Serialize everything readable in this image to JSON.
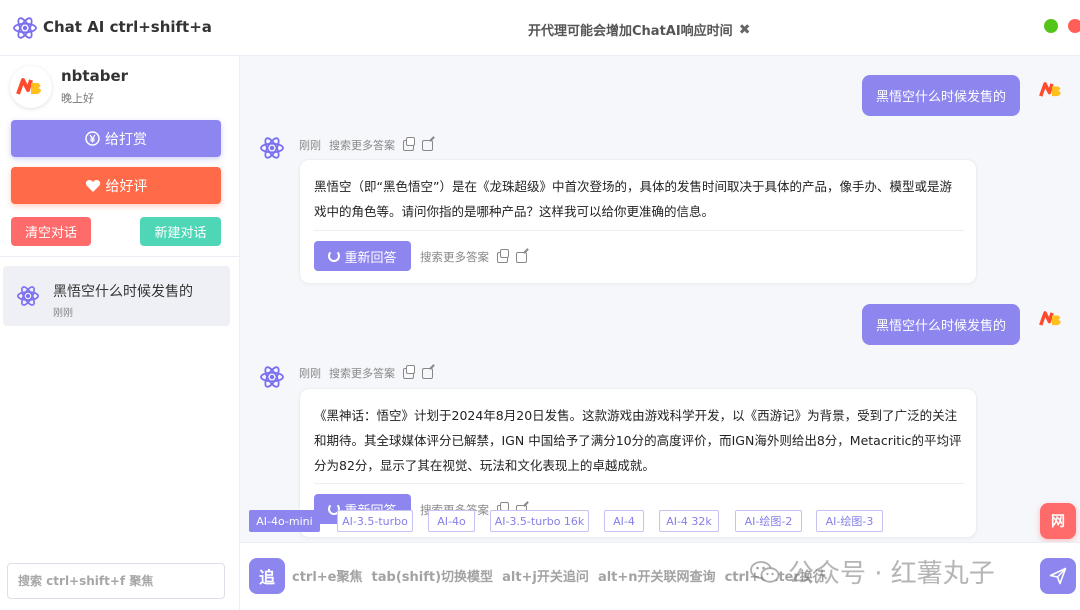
{
  "app": {
    "title": "Chat AI ctrl+shift+a",
    "notice": "开代理可能会增加ChatAI响应时间",
    "notice_close": "✖"
  },
  "sidebar": {
    "username": "nbtaber",
    "greeting": "晚上好",
    "reward_label": "给打赏",
    "review_label": "给好评",
    "clear_label": "清空对话",
    "new_label": "新建对话",
    "conversations": [
      {
        "title": "黑悟空什么时候发售的",
        "time": "刚刚"
      }
    ],
    "search_placeholder": "搜索 ctrl+shift+f 聚焦"
  },
  "chat": {
    "messages": [
      {
        "role": "user",
        "text": "黑悟空什么时候发售的"
      },
      {
        "role": "bot",
        "time": "刚刚",
        "more_answers": "搜索更多答案",
        "text": "黑悟空（即“黑色悟空”）是在《龙珠超级》中首次登场的，具体的发售时间取决于具体的产品，像手办、模型或是游戏中的角色等。请问你指的是哪种产品？这样我可以给你更准确的信息。",
        "regenerate": "重新回答"
      },
      {
        "role": "user",
        "text": "黑悟空什么时候发售的"
      },
      {
        "role": "bot",
        "time": "刚刚",
        "more_answers": "搜索更多答案",
        "text": "《黑神话：悟空》计划于2024年8月20日发售。这款游戏由游戏科学开发，以《西游记》为背景，受到了广泛的关注和期待。其全球媒体评分已解禁，IGN 中国给予了满分10分的高度评价，而IGN海外则给出8分，Metacritic的平均评分为82分，显示了其在视觉、玩法和文化表现上的卓越成就。",
        "regenerate": "重新回答"
      }
    ]
  },
  "models": {
    "selected": "AI-4o-mini",
    "items": [
      "AI-4o-mini",
      "AI-3.5-turbo",
      "AI-4o",
      "AI-3.5-turbo 16k",
      "AI-4",
      "AI-4 32k",
      "AI-绘图-2",
      "AI-绘图-3"
    ]
  },
  "net_button": "网",
  "input": {
    "follow_label": "追",
    "placeholder": "ctrl+e聚焦  tab(shift)切换模型  alt+j开关追问  alt+n开关联网查询  ctrl+enter换行"
  },
  "watermark": "公众号 · 红薯丸子",
  "colors": {
    "accent": "#8c86ee",
    "review": "#ff6a48",
    "clear": "#ff6b6b",
    "new": "#4fd6b6"
  }
}
